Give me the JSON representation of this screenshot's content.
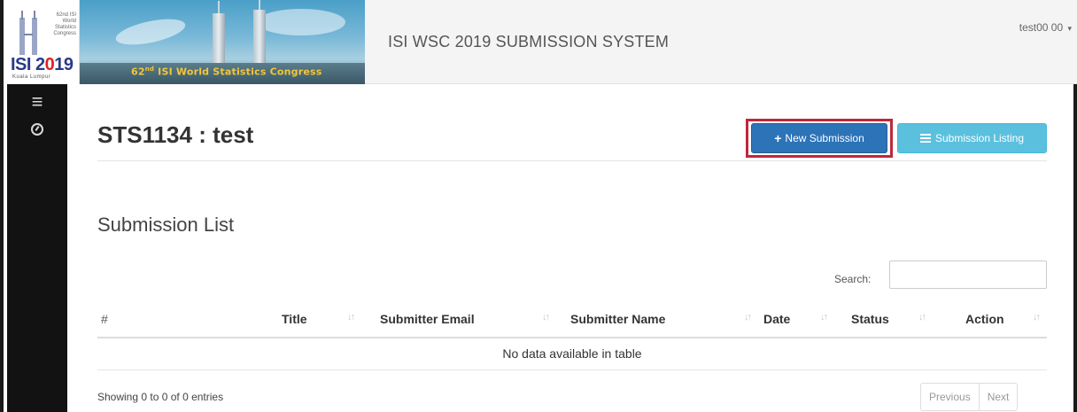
{
  "logo": {
    "small_text": "62nd ISI World Statistics Congress",
    "year_prefix": "ISI 2",
    "year_hot": "0",
    "year_suffix": "19",
    "sub": "Kuala Lumpur"
  },
  "banner": {
    "caption_num": "62",
    "caption_sup": "nd",
    "caption_rest": " ISI World Statistics Congress"
  },
  "header": {
    "app_title": "ISI WSC 2019 SUBMISSION SYSTEM",
    "user": "test00 00",
    "user_caret": "▾"
  },
  "sidenav": {
    "items": [
      {
        "icon": "menu-icon",
        "glyph": "≡"
      },
      {
        "icon": "dashboard-gauge-icon"
      }
    ]
  },
  "page": {
    "title": "STS1134 : test",
    "buttons": {
      "new_submission": "New Submission",
      "new_submission_glyph": "+",
      "submission_listing": "Submission Listing"
    },
    "section_title": "Submission List"
  },
  "table": {
    "search_label": "Search:",
    "search_value": "",
    "columns": [
      "#",
      "Title",
      "Submitter Email",
      "Submitter Name",
      "Date",
      "Status",
      "Action"
    ],
    "sort_glyph": "↓↑",
    "empty_message": "No data available in table",
    "info": "Showing 0 to 0 of 0 entries",
    "pager": {
      "previous": "Previous",
      "next": "Next"
    }
  },
  "colors": {
    "primary": "#2c73b7",
    "info": "#5bc0de",
    "highlight": "#c0273a",
    "sidebar": "#121212"
  }
}
